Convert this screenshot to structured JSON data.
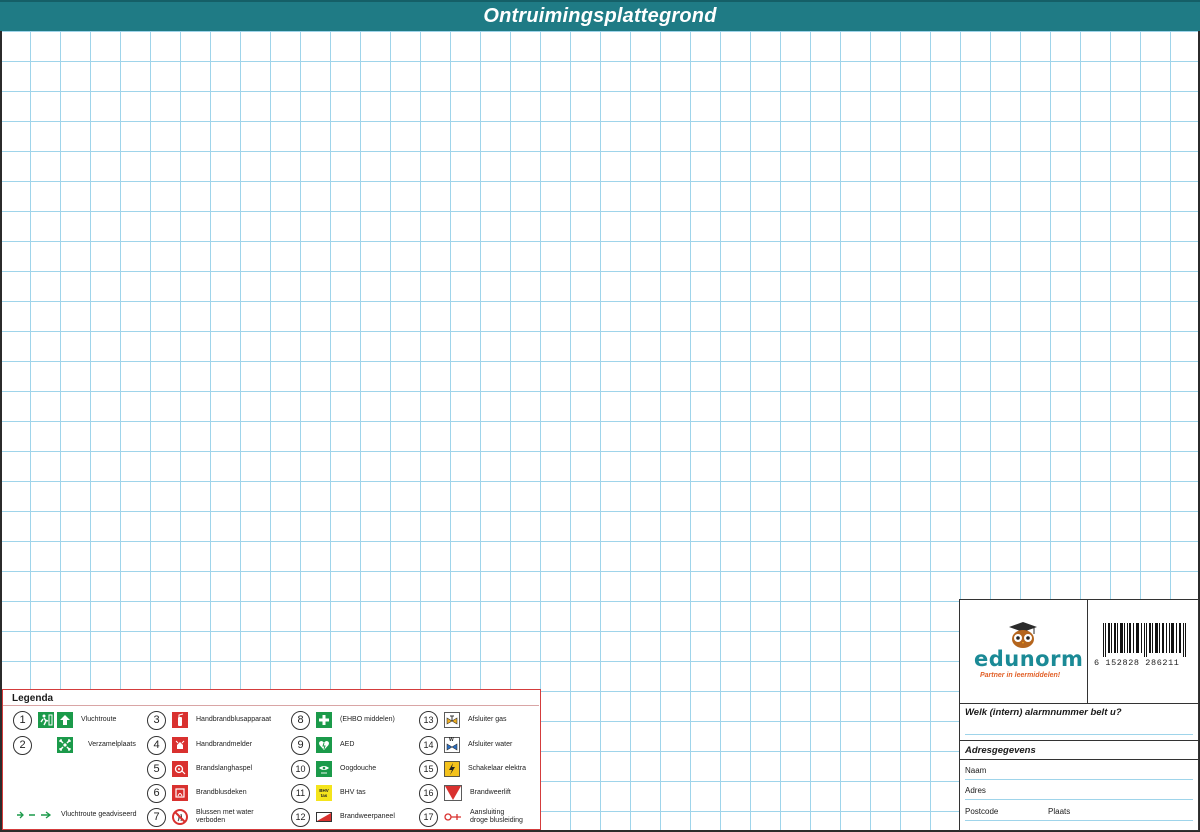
{
  "document": {
    "title": "Ontruimingsplattegrond",
    "colors": {
      "title_bar": "#1f7b85",
      "grid_lines": "#9fd4ea",
      "legend_border": "#d43c3c",
      "safety_green": "#1b9a4a",
      "fire_red": "#d9312f",
      "logo_teal": "#1b8a96",
      "logo_orange": "#e2622a"
    }
  },
  "legend": {
    "title": "Legenda",
    "items": [
      {
        "num": "1",
        "label": "Vluchtroute",
        "icon": "escape-route-arrows-icon"
      },
      {
        "num": "2",
        "label": "Verzamelplaats",
        "icon": "assembly-point-icon"
      },
      {
        "num": "3",
        "label": "Handbrandblusapparaat",
        "icon": "fire-extinguisher-icon"
      },
      {
        "num": "4",
        "label": "Handbrandmelder",
        "icon": "fire-alarm-call-point-icon"
      },
      {
        "num": "5",
        "label": "Brandslanghaspel",
        "icon": "fire-hose-reel-icon"
      },
      {
        "num": "6",
        "label": "Brandblusdeken",
        "icon": "fire-blanket-icon"
      },
      {
        "num": "7",
        "label": "Blussen met water verboden",
        "label_line1": "Blussen met water",
        "label_line2": "verboden",
        "icon": "no-water-extinguishing-icon"
      },
      {
        "num": "8",
        "label": "(EHBO middelen)",
        "icon": "first-aid-icon"
      },
      {
        "num": "9",
        "label": "AED",
        "icon": "aed-icon"
      },
      {
        "num": "10",
        "label": "Oogdouche",
        "icon": "eye-shower-icon"
      },
      {
        "num": "11",
        "label": "BHV tas",
        "icon": "bhv-bag-icon",
        "icon_text": "BHV tas"
      },
      {
        "num": "12",
        "label": "Brandweerpaneel",
        "icon": "fire-brigade-panel-icon"
      },
      {
        "num": "13",
        "label": "Afsluiter gas",
        "icon": "gas-valve-icon"
      },
      {
        "num": "14",
        "label": "Afsluiter water",
        "icon": "water-valve-icon",
        "icon_text": "W"
      },
      {
        "num": "15",
        "label": "Schakelaar elektra",
        "icon": "electrical-switch-icon"
      },
      {
        "num": "16",
        "label": "Brandweerlift",
        "icon": "fire-lift-icon"
      },
      {
        "num": "17",
        "label": "Aansluiting droge blusleiding",
        "label_line1": "Aansluiting",
        "label_line2": "droge blusleiding",
        "icon": "dry-riser-connection-icon"
      }
    ],
    "escape_route_seen": "Vluchtroute geadviseerd"
  },
  "info_panel": {
    "logo": {
      "word": "edunorm",
      "tagline": "Partner in leermiddelen!"
    },
    "barcode_number": "6 152828 286211",
    "alarm_question": "Welk (intern) alarmnummer belt u?",
    "address_heading": "Adresgegevens",
    "fields": {
      "name": "Naam",
      "address": "Adres",
      "postcode": "Postcode",
      "city": "Plaats"
    }
  }
}
